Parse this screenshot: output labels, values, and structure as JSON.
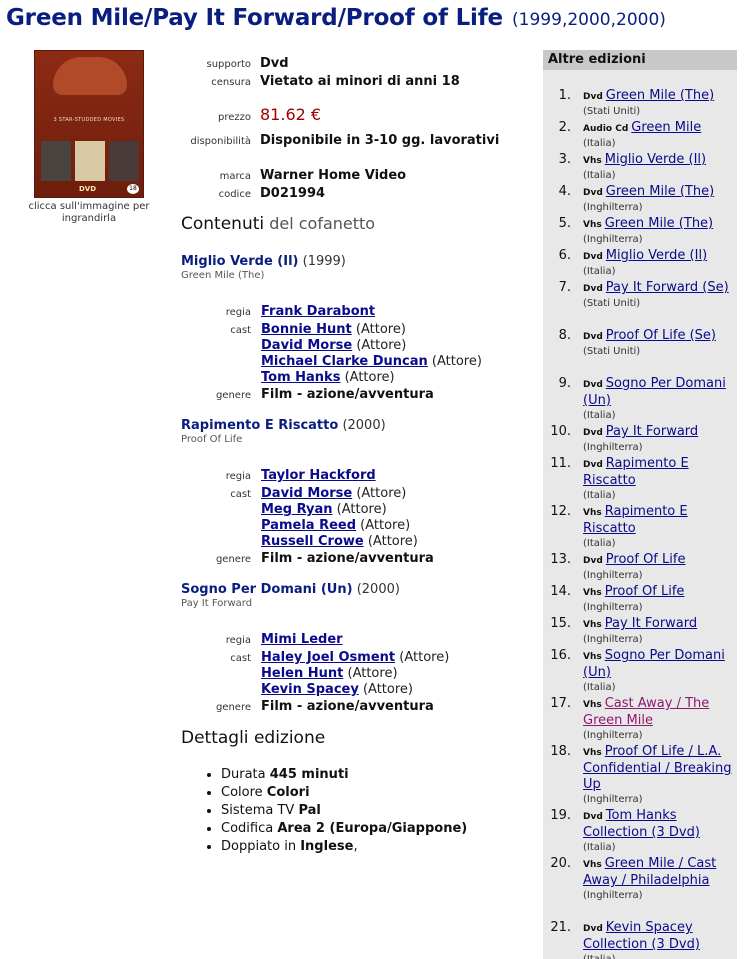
{
  "title": {
    "main": "Green Mile/Pay It Forward/Proof of Life",
    "years": "(1999,2000,2000)"
  },
  "cover": {
    "caption": "clicca sull'immagine per ingrandirla",
    "strip_text": "3 STAR-STUDDED MOVIES",
    "dvd_text": "DVD",
    "age_text": "18"
  },
  "meta": {
    "supporto_label": "supporto",
    "supporto": "Dvd",
    "censura_label": "censura",
    "censura": "Vietato ai minori di anni 18",
    "prezzo_label": "prezzo",
    "prezzo": "81.62 €",
    "disponibilita_label": "disponibilità",
    "disponibilita": "Disponibile in 3-10 gg. lavorativi",
    "marca_label": "marca",
    "marca": "Warner Home Video",
    "codice_label": "codice",
    "codice": "D021994"
  },
  "contents": {
    "heading_main": "Contenuti",
    "heading_rest": " del cofanetto",
    "labels": {
      "regia": "regia",
      "cast": "cast",
      "genere": "genere"
    },
    "films": [
      {
        "title": "Miglio Verde (Il)",
        "year": "(1999)",
        "original": "Green Mile (The)",
        "regia": "Frank Darabont",
        "cast": [
          {
            "name": "Bonnie Hunt",
            "role": "(Attore)"
          },
          {
            "name": "David Morse",
            "role": "(Attore)"
          },
          {
            "name": "Michael Clarke Duncan",
            "role": "(Attore)"
          },
          {
            "name": "Tom Hanks",
            "role": "(Attore)"
          }
        ],
        "genere": "Film - azione/avventura"
      },
      {
        "title": "Rapimento E Riscatto",
        "year": "(2000)",
        "original": "Proof Of Life",
        "regia": "Taylor Hackford",
        "cast": [
          {
            "name": "David Morse",
            "role": "(Attore)"
          },
          {
            "name": "Meg Ryan",
            "role": "(Attore)"
          },
          {
            "name": "Pamela Reed",
            "role": "(Attore)"
          },
          {
            "name": "Russell Crowe",
            "role": "(Attore)"
          }
        ],
        "genere": "Film - azione/avventura"
      },
      {
        "title": "Sogno Per Domani (Un)",
        "year": "(2000)",
        "original": "Pay It Forward",
        "regia": "Mimi Leder",
        "cast": [
          {
            "name": "Haley Joel Osment",
            "role": "(Attore)"
          },
          {
            "name": "Helen Hunt",
            "role": "(Attore)"
          },
          {
            "name": "Kevin Spacey",
            "role": "(Attore)"
          }
        ],
        "genere": "Film - azione/avventura"
      }
    ]
  },
  "details": {
    "heading": "Dettagli edizione",
    "items": [
      {
        "label": "Durata ",
        "value": "445 minuti",
        "suffix": ""
      },
      {
        "label": "Colore ",
        "value": "Colori",
        "suffix": ""
      },
      {
        "label": "Sistema TV ",
        "value": "Pal",
        "suffix": ""
      },
      {
        "label": "Codifica ",
        "value": "Area 2 (Europa/Giappone)",
        "suffix": ""
      },
      {
        "label": "Doppiato in ",
        "value": "Inglese",
        "suffix": ","
      }
    ]
  },
  "sidebar": {
    "heading": "Altre edizioni",
    "editions": [
      {
        "num": "1.",
        "format": "Dvd",
        "title": "Green Mile (The)",
        "country": "(Stati Uniti)"
      },
      {
        "num": "2.",
        "format": "Audio Cd",
        "title": "Green Mile",
        "country": "(Italia)"
      },
      {
        "num": "3.",
        "format": "Vhs",
        "title": "Miglio Verde (Il)",
        "country": "(Italia)"
      },
      {
        "num": "4.",
        "format": "Dvd",
        "title": "Green Mile (The)",
        "country": "(Inghilterra)"
      },
      {
        "num": "5.",
        "format": "Vhs",
        "title": "Green Mile (The)",
        "country": "(Inghilterra)"
      },
      {
        "num": "6.",
        "format": "Dvd",
        "title": "Miglio Verde (Il)",
        "country": "(Italia)"
      },
      {
        "num": "7.",
        "format": "Dvd",
        "title": "Pay It Forward (Se)",
        "country": "(Stati Uniti)"
      },
      {
        "num": "8.",
        "format": "Dvd",
        "title": "Proof Of Life (Se)",
        "country": "(Stati Uniti)"
      },
      {
        "num": "9.",
        "format": "Dvd",
        "title": "Sogno Per Domani (Un)",
        "country": "(Italia)"
      },
      {
        "num": "10.",
        "format": "Dvd",
        "title": "Pay It Forward",
        "country": "(Inghilterra)"
      },
      {
        "num": "11.",
        "format": "Dvd",
        "title": "Rapimento E Riscatto",
        "country": "(Italia)"
      },
      {
        "num": "12.",
        "format": "Vhs",
        "title": "Rapimento E Riscatto",
        "country": "(Italia)"
      },
      {
        "num": "13.",
        "format": "Dvd",
        "title": "Proof Of Life",
        "country": "(Inghilterra)"
      },
      {
        "num": "14.",
        "format": "Vhs",
        "title": "Proof Of Life",
        "country": "(Inghilterra)"
      },
      {
        "num": "15.",
        "format": "Vhs",
        "title": "Pay It Forward",
        "country": "(Inghilterra)"
      },
      {
        "num": "16.",
        "format": "Vhs",
        "title": "Sogno Per Domani (Un)",
        "country": "(Italia)"
      },
      {
        "num": "17.",
        "format": "Vhs",
        "title": "Cast Away / The Green Mile",
        "country": "(Inghilterra)",
        "visited": true
      },
      {
        "num": "18.",
        "format": "Vhs",
        "title": "Proof Of Life / L.A. Confidential / Breaking Up",
        "country": "(Inghilterra)"
      },
      {
        "num": "19.",
        "format": "Dvd",
        "title": "Tom Hanks Collection (3 Dvd)",
        "country": "(Italia)"
      },
      {
        "num": "20.",
        "format": "Vhs",
        "title": "Green Mile / Cast Away / Philadelphia",
        "country": "(Inghilterra)"
      },
      {
        "num": "21.",
        "format": "Dvd",
        "title": "Kevin Spacey Collection (3 Dvd)",
        "country": "(Italia)"
      }
    ]
  }
}
